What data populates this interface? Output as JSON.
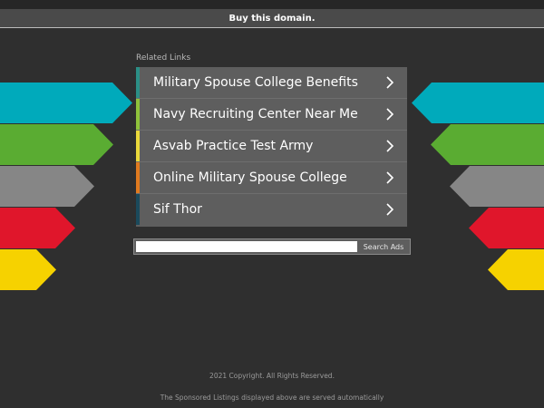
{
  "header": {
    "buy_domain_label": "Buy this domain."
  },
  "related": {
    "heading": "Related Links",
    "links": [
      {
        "label": "Military Spouse College Benefits",
        "accent": "#2b8f86"
      },
      {
        "label": "Navy Recruiting Center Near Me",
        "accent": "#8fc23b"
      },
      {
        "label": "Asvab Practice Test Army",
        "accent": "#ead83a"
      },
      {
        "label": "Online Military Spouse College",
        "accent": "#e07a1f"
      },
      {
        "label": "Sif Thor",
        "accent": "#1b4a5c"
      }
    ]
  },
  "search": {
    "placeholder": "",
    "button_label": "Search Ads"
  },
  "footer": {
    "copyright": "2021 Copyright. All Rights Reserved.",
    "disclaimer": "The Sponsored Listings displayed above are served automatically"
  },
  "decor": {
    "arrows": [
      {
        "color": "#00aabb"
      },
      {
        "color": "#5aac32"
      },
      {
        "color": "#868686"
      },
      {
        "color": "#e0162b"
      },
      {
        "color": "#f6d200"
      }
    ]
  }
}
